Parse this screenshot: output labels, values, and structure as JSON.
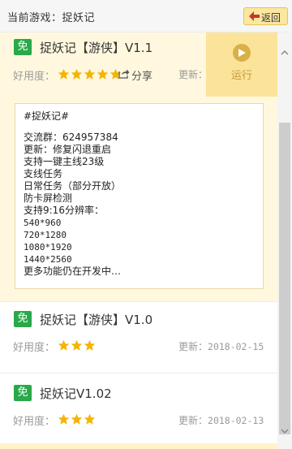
{
  "header": {
    "title": "当前游戏：捉妖记",
    "back_label": "返回"
  },
  "colors": {
    "free_badge": "#2aa84a",
    "star": "#f5b400",
    "run_panel": "#fbe49a",
    "active_row": "#fff8de"
  },
  "labels": {
    "rating": "好用度：",
    "update": "更新："
  },
  "scripts": [
    {
      "badge": "免",
      "title": "捉妖记【游侠】V1.1",
      "stars": 5,
      "share_label": "分享",
      "update_date": "",
      "run_label": "运行",
      "description": [
        "#捉妖记#",
        "",
        "交流群：624957384",
        "更新：修复闪退重启",
        "支持一键主线23级",
        "支线任务",
        "日常任务（部分开放）",
        "防卡屏检测",
        "支持9:16分辨率：",
        "540*960",
        "720*1280",
        "1080*1920",
        "1440*2560",
        "更多功能仍在开发中…"
      ]
    },
    {
      "badge": "免",
      "title": "捉妖记【游侠】V1.0",
      "stars": 3,
      "update_date": "2018-02-15"
    },
    {
      "badge": "免",
      "title": "捉妖记V1.02",
      "stars": 3,
      "update_date": "2018-02-13"
    }
  ],
  "icons": {
    "back": "back-arrow-icon",
    "share": "share-icon",
    "run": "play-icon",
    "star": "star-icon"
  }
}
